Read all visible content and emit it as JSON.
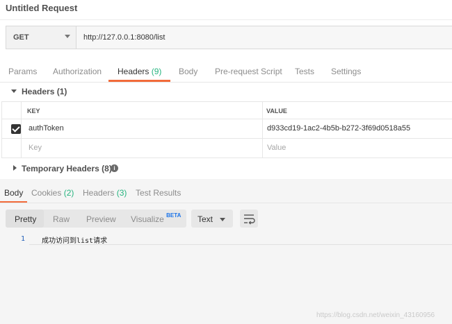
{
  "request": {
    "title": "Untitled Request",
    "method": "GET",
    "url": "http://127.0.0.1:8080/list"
  },
  "request_tabs": [
    {
      "label": "Params"
    },
    {
      "label": "Authorization"
    },
    {
      "label": "Headers",
      "count": "(9)",
      "active": true
    },
    {
      "label": "Body"
    },
    {
      "label": "Pre-request Script"
    },
    {
      "label": "Tests"
    },
    {
      "label": "Settings"
    }
  ],
  "headers_section": {
    "title": "Headers",
    "count": "(1)",
    "columns": {
      "key": "KEY",
      "value": "VALUE"
    },
    "rows": [
      {
        "checked": true,
        "key": "authToken",
        "value": "d933cd19-1ac2-4b5b-b272-3f69d0518a55"
      }
    ],
    "placeholder": {
      "key": "Key",
      "value": "Value"
    }
  },
  "temporary_headers": {
    "title": "Temporary Headers",
    "count": "(8)",
    "info_icon": "info-icon"
  },
  "response_tabs": [
    {
      "label": "Body",
      "active": true
    },
    {
      "label": "Cookies",
      "count": "(2)"
    },
    {
      "label": "Headers",
      "count": "(3)"
    },
    {
      "label": "Test Results"
    }
  ],
  "view_modes": [
    {
      "label": "Pretty",
      "active": true
    },
    {
      "label": "Raw"
    },
    {
      "label": "Preview"
    },
    {
      "label": "Visualize",
      "badge": "BETA"
    }
  ],
  "format": {
    "selected": "Text"
  },
  "wrap_icon": "wrap-lines-icon",
  "response_body": {
    "line_number": "1",
    "text": "成功访问到list请求"
  },
  "watermark": "https://blog.csdn.net/weixin_43160956",
  "colors": {
    "accent": "#f26b3a",
    "count_green": "#26b47f",
    "beta_blue": "#1a73e8"
  }
}
